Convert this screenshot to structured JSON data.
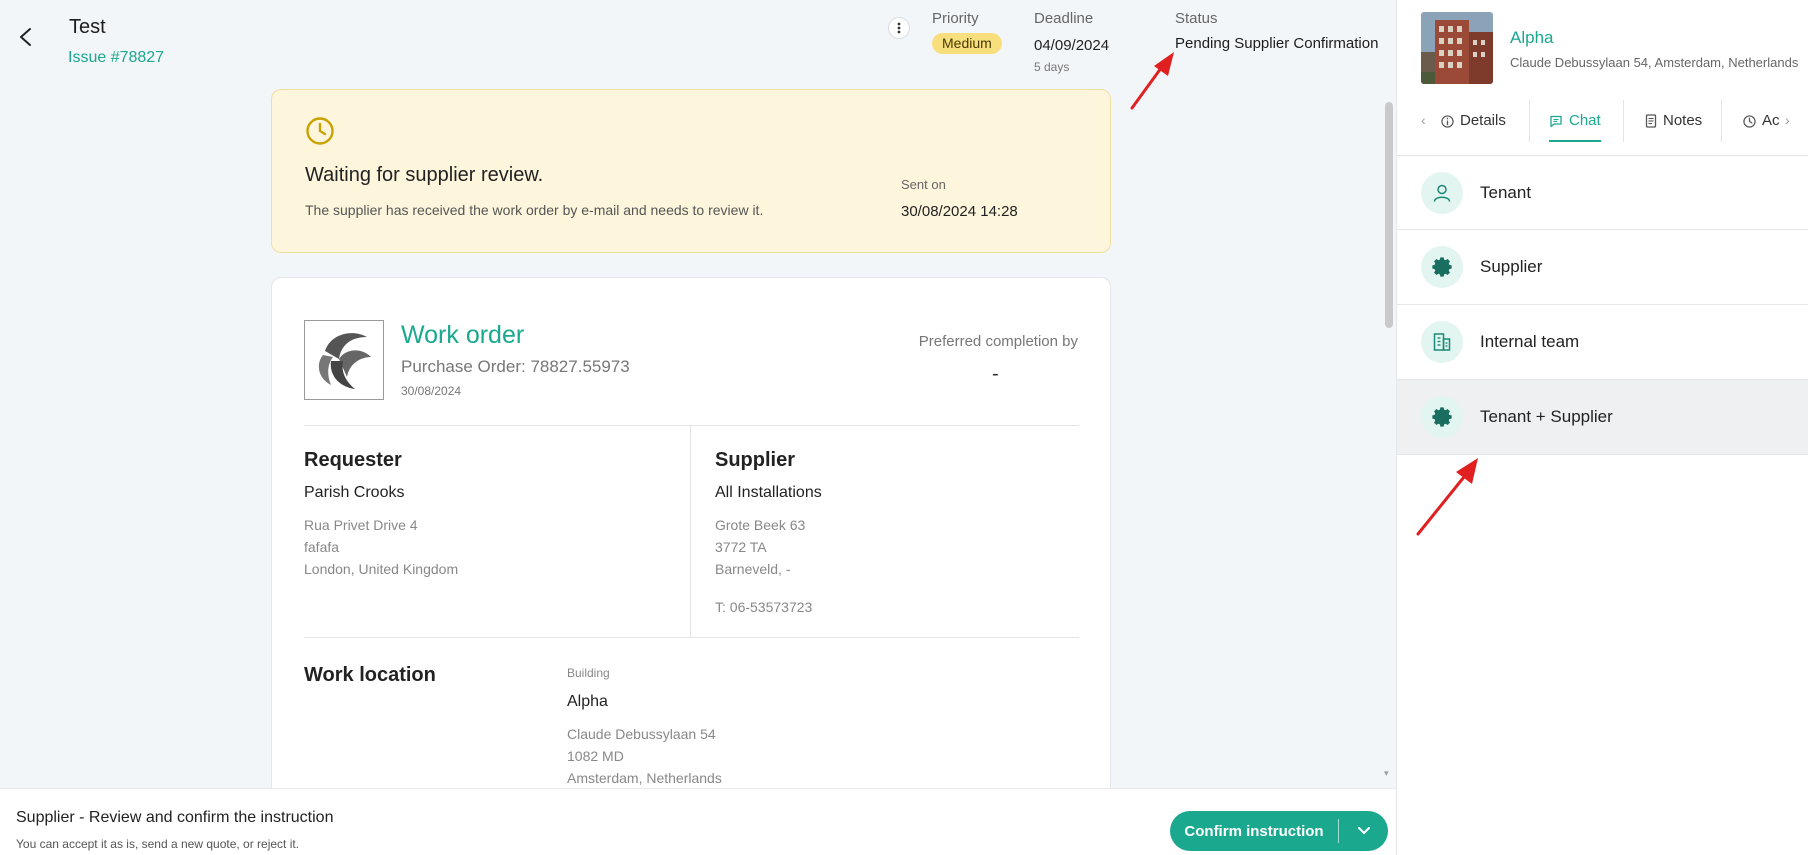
{
  "header": {
    "title": "Test",
    "issue": "Issue #78827",
    "priority_label": "Priority",
    "priority_value": "Medium",
    "deadline_label": "Deadline",
    "deadline_value": "04/09/2024",
    "deadline_remaining": "5 days",
    "status_label": "Status",
    "status_value": "Pending Supplier Confirmation"
  },
  "banner": {
    "title": "Waiting for supplier review.",
    "message": "The supplier has received the work order by e-mail and needs to review it.",
    "sent_label": "Sent on",
    "sent_value": "30/08/2024 14:28"
  },
  "work_order": {
    "title": "Work order",
    "purchase_order": "Purchase Order: 78827.55973",
    "date": "30/08/2024",
    "preferred_label": "Preferred completion by",
    "preferred_value": "-",
    "requester": {
      "heading": "Requester",
      "name": "Parish Crooks",
      "address": [
        "Rua Privet Drive 4",
        "fafafa",
        "London, United Kingdom"
      ]
    },
    "supplier": {
      "heading": "Supplier",
      "name": "All Installations",
      "address": [
        "Grote Beek 63",
        "3772 TA",
        "Barneveld, -"
      ],
      "phone": "T: 06-53573723"
    },
    "location": {
      "heading": "Work location",
      "building_label": "Building",
      "building_name": "Alpha",
      "address": [
        "Claude Debussylaan 54",
        "1082 MD",
        "Amsterdam, Netherlands"
      ]
    }
  },
  "footer": {
    "title": "Supplier - Review and confirm the instruction",
    "subtitle": "You can accept it as is, send a new quote, or reject it.",
    "confirm_label": "Confirm instruction"
  },
  "sidebar": {
    "building_name": "Alpha",
    "building_address": "Claude Debussylaan 54, Amsterdam, Netherlands",
    "tabs": [
      {
        "label": "Details",
        "icon": "info-icon"
      },
      {
        "label": "Chat",
        "icon": "chat-icon",
        "active": true
      },
      {
        "label": "Notes",
        "icon": "notes-icon"
      },
      {
        "label": "Ac",
        "icon": "clock-icon"
      }
    ],
    "chats": [
      {
        "label": "Tenant",
        "icon": "person-icon"
      },
      {
        "label": "Supplier",
        "icon": "gear-icon"
      },
      {
        "label": "Internal team",
        "icon": "building-icon"
      },
      {
        "label": "Tenant + Supplier",
        "icon": "gear-icon",
        "selected": true
      }
    ]
  },
  "colors": {
    "accent": "#1aa88f",
    "banner_bg": "#fdf6dc",
    "priority_badge": "#f7df7e",
    "annotation_arrow": "#e02020"
  }
}
